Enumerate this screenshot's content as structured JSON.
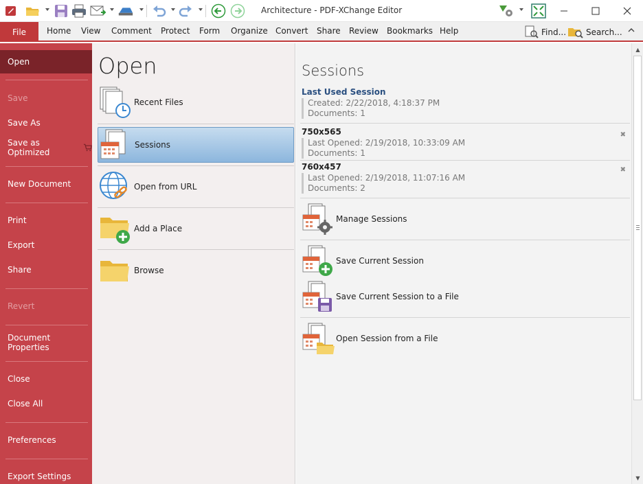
{
  "window": {
    "title": "Architecture - PDF-XChange Editor"
  },
  "colors": {
    "accent": "#c0393b",
    "sidebar_bg": "#c5434a",
    "sidebar_active": "#7a2329",
    "selection": "#8cb6dd"
  },
  "toolbar": {
    "icons": [
      "app-icon",
      "open-folder-icon",
      "save-icon",
      "print-icon",
      "email-icon",
      "scan-icon",
      "undo-icon",
      "redo-icon",
      "back-icon",
      "forward-icon",
      "settings-icon",
      "fullscreen-icon"
    ]
  },
  "menu": {
    "file": "File",
    "items": [
      "Home",
      "View",
      "Comment",
      "Protect",
      "Form",
      "Organize",
      "Convert",
      "Share",
      "Review",
      "Bookmarks",
      "Help"
    ],
    "find": "Find...",
    "search": "Search..."
  },
  "backstage": {
    "items": [
      {
        "label": "Open"
      },
      {
        "label": "Save"
      },
      {
        "label": "Save As"
      },
      {
        "label": "Save as Optimized"
      },
      {
        "label": "New Document"
      },
      {
        "label": "Print"
      },
      {
        "label": "Export"
      },
      {
        "label": "Share"
      },
      {
        "label": "Revert"
      },
      {
        "label": "Document Properties"
      },
      {
        "label": "Close"
      },
      {
        "label": "Close All"
      },
      {
        "label": "Preferences"
      },
      {
        "label": "Export Settings"
      }
    ]
  },
  "open": {
    "title": "Open",
    "items": [
      {
        "label": "Recent Files"
      },
      {
        "label": "Sessions"
      },
      {
        "label": "Open from URL"
      },
      {
        "label": "Add a Place"
      },
      {
        "label": "Browse"
      }
    ]
  },
  "sessions": {
    "title": "Sessions",
    "list": [
      {
        "name": "Last Used Session",
        "line1": "Created: 2/22/2018, 4:18:37 PM",
        "line2": "Documents: 1"
      },
      {
        "name": "750x565",
        "line1": "Last Opened: 2/19/2018, 10:33:09 AM",
        "line2": "Documents: 1"
      },
      {
        "name": "760x457",
        "line1": "Last Opened: 2/19/2018, 11:07:16 AM",
        "line2": "Documents: 2"
      }
    ],
    "actions": [
      {
        "label": "Manage Sessions"
      },
      {
        "label": "Save Current Session"
      },
      {
        "label": "Save Current Session to a File"
      },
      {
        "label": "Open Session from a File"
      }
    ]
  }
}
